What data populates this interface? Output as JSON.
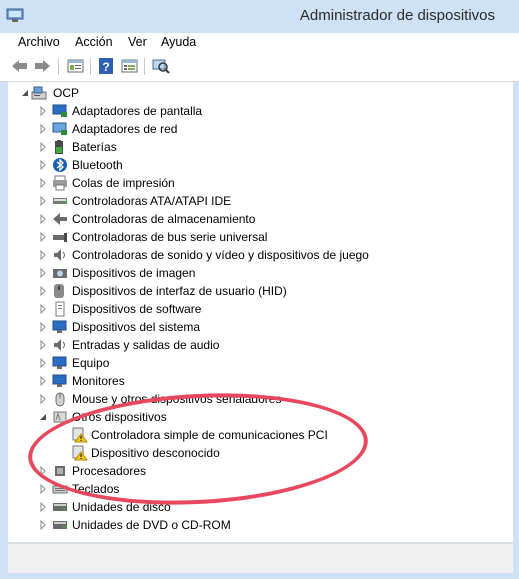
{
  "window": {
    "title": "Administrador de dispositivos"
  },
  "menu": [
    "Archivo",
    "Acción",
    "Ver",
    "Ayuda"
  ],
  "toolbar": [
    "back-icon",
    "forward-icon",
    "properties-icon",
    "help-icon",
    "view-icon",
    "scan-hardware-icon"
  ],
  "tree": {
    "root": "OCP",
    "items": [
      {
        "label": "Adaptadores de pantalla",
        "icon": "display-adapter-icon",
        "expanded": false
      },
      {
        "label": "Adaptadores de red",
        "icon": "network-adapter-icon",
        "expanded": false
      },
      {
        "label": "Baterías",
        "icon": "battery-icon",
        "expanded": false
      },
      {
        "label": "Bluetooth",
        "icon": "bluetooth-icon",
        "expanded": false
      },
      {
        "label": "Colas de impresión",
        "icon": "printer-icon",
        "expanded": false
      },
      {
        "label": "Controladoras ATA/ATAPI IDE",
        "icon": "ide-controller-icon",
        "expanded": false
      },
      {
        "label": "Controladoras de almacenamiento",
        "icon": "storage-controller-icon",
        "expanded": false
      },
      {
        "label": "Controladoras de bus serie universal",
        "icon": "usb-icon",
        "expanded": false
      },
      {
        "label": "Controladoras de sonido y vídeo y dispositivos de juego",
        "icon": "speaker-icon",
        "expanded": false
      },
      {
        "label": "Dispositivos de imagen",
        "icon": "camera-icon",
        "expanded": false
      },
      {
        "label": "Dispositivos de interfaz de usuario (HID)",
        "icon": "hid-icon",
        "expanded": false
      },
      {
        "label": "Dispositivos de software",
        "icon": "software-device-icon",
        "expanded": false
      },
      {
        "label": "Dispositivos del sistema",
        "icon": "system-device-icon",
        "expanded": false
      },
      {
        "label": "Entradas y salidas de audio",
        "icon": "audio-io-icon",
        "expanded": false
      },
      {
        "label": "Equipo",
        "icon": "computer-icon",
        "expanded": false
      },
      {
        "label": "Monitores",
        "icon": "monitor-icon",
        "expanded": false
      },
      {
        "label": "Mouse y otros dispositivos señaladores",
        "icon": "mouse-icon",
        "expanded": false
      },
      {
        "label": "Otros dispositivos",
        "icon": "other-devices-icon",
        "expanded": true,
        "children": [
          {
            "label": "Controladora simple de comunicaciones PCI",
            "icon": "warning-device-icon"
          },
          {
            "label": "Dispositivo desconocido",
            "icon": "warning-device-icon"
          }
        ]
      },
      {
        "label": "Procesadores",
        "icon": "processor-icon",
        "expanded": false
      },
      {
        "label": "Teclados",
        "icon": "keyboard-icon",
        "expanded": false
      },
      {
        "label": "Unidades de disco",
        "icon": "disk-drive-icon",
        "expanded": false
      },
      {
        "label": "Unidades de DVD o CD-ROM",
        "icon": "dvd-drive-icon",
        "expanded": false
      }
    ]
  },
  "colors": {
    "title_bg": "#cfe1f4",
    "highlight_ellipse": "#e8485e",
    "warning": "#f2c811"
  }
}
